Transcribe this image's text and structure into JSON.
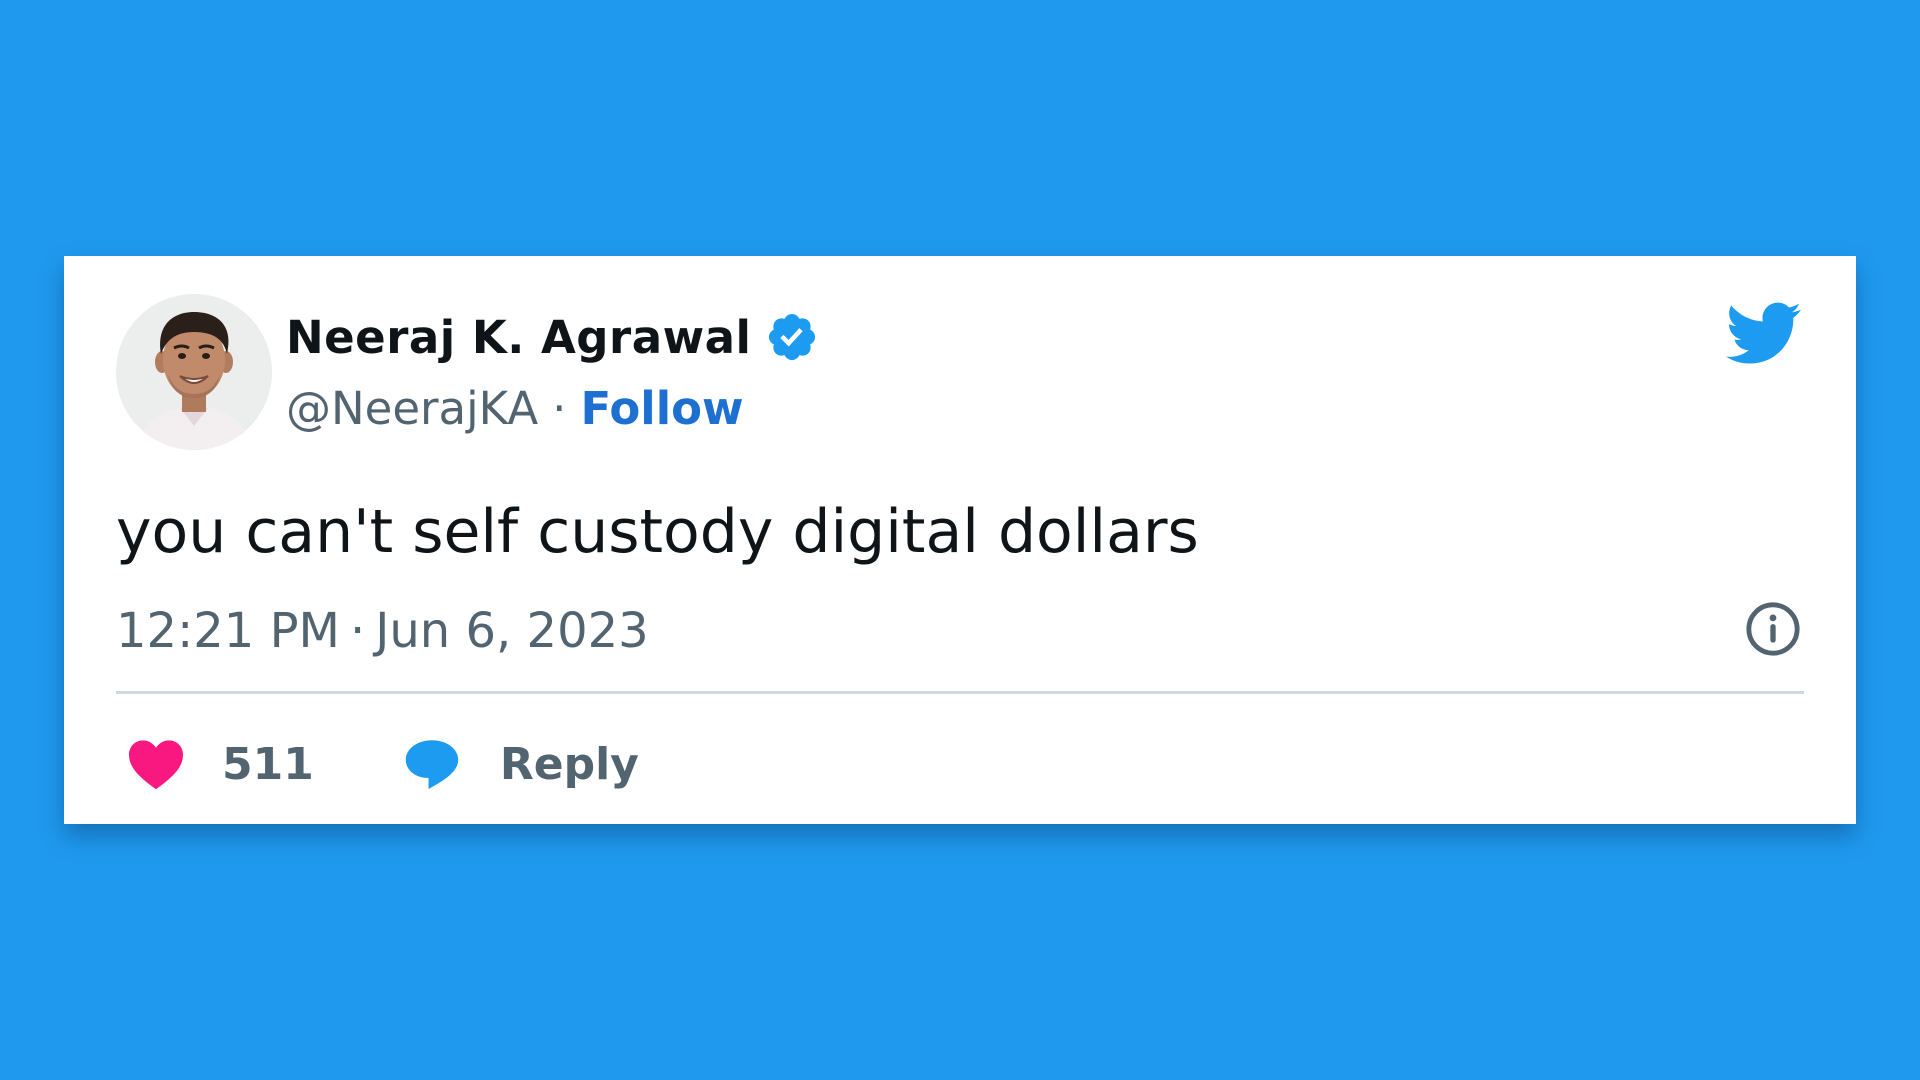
{
  "tweet": {
    "author": {
      "name": "Neeraj K. Agrawal",
      "handle": "@NeerajKA",
      "verified": true,
      "avatar_icon": "profile-photo"
    },
    "separator": "·",
    "follow_label": "Follow",
    "text": "you can't self custody digital dollars",
    "time": "12:21 PM",
    "date": "Jun 6, 2023",
    "likes": "511",
    "reply_label": "Reply",
    "icons": {
      "brand": "twitter-bird-icon",
      "verified": "verified-badge-icon",
      "info": "info-icon",
      "like": "heart-icon",
      "reply": "reply-bubble-icon"
    }
  },
  "colors": {
    "background": "#1f99ee",
    "card": "#ffffff",
    "name_text": "#0f1419",
    "secondary_text": "#536471",
    "follow_link": "#1d6fd0",
    "twitter_blue": "#1d9bf0",
    "heart": "#f91880",
    "divider": "#cfd9de"
  }
}
